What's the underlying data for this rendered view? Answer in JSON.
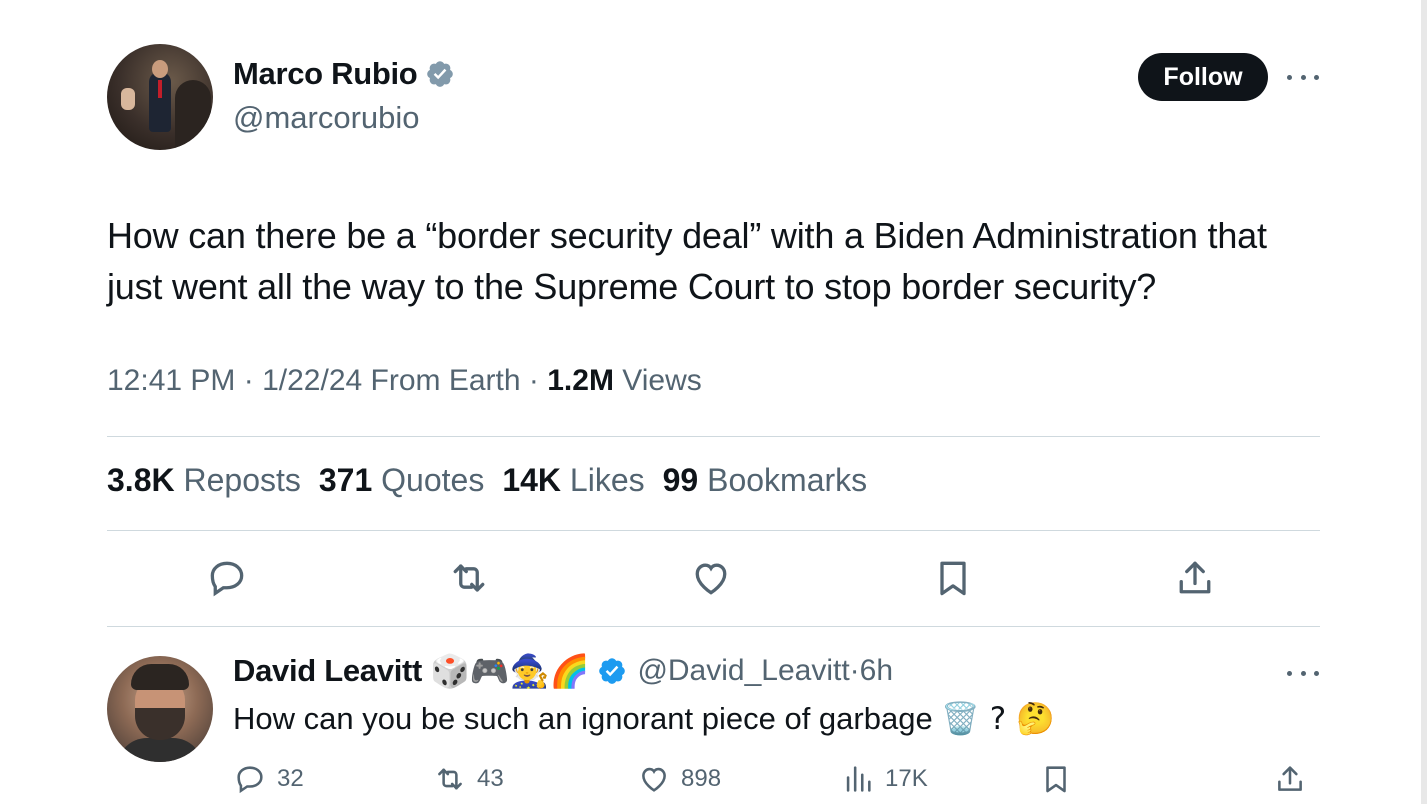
{
  "tweet": {
    "author": {
      "name": "Marco Rubio",
      "handle": "@marcorubio",
      "verified_color": "#829aab"
    },
    "follow_label": "Follow",
    "text": "How can there be a “border security deal” with a Biden Administration that just went all the way to the Supreme Court to stop border security?",
    "meta": {
      "time": "12:41 PM",
      "date": "1/22/24",
      "source": "From Earth",
      "views_count": "1.2M",
      "views_label": "Views"
    },
    "stats": [
      {
        "count": "3.8K",
        "label": "Reposts"
      },
      {
        "count": "371",
        "label": "Quotes"
      },
      {
        "count": "14K",
        "label": "Likes"
      },
      {
        "count": "99",
        "label": "Bookmarks"
      }
    ],
    "actions": [
      "reply-icon",
      "repost-icon",
      "like-icon",
      "bookmark-icon",
      "share-icon"
    ]
  },
  "reply": {
    "author": {
      "name": "David Leavitt",
      "emojis": "🎲🎮🧙🌈",
      "handle": "@David_Leavitt",
      "time": "6h",
      "verified_color": "#1d9bf0"
    },
    "text": "How can you be such an ignorant piece of garbage",
    "text_emojis": "🗑️ ? 🤔",
    "stats": {
      "replies": "32",
      "reposts": "43",
      "likes": "898",
      "views": "17K"
    }
  },
  "colors": {
    "text_primary": "#0f1419",
    "text_secondary": "#536471",
    "divider": "#cfd9de",
    "follow_bg": "#0f1419"
  }
}
